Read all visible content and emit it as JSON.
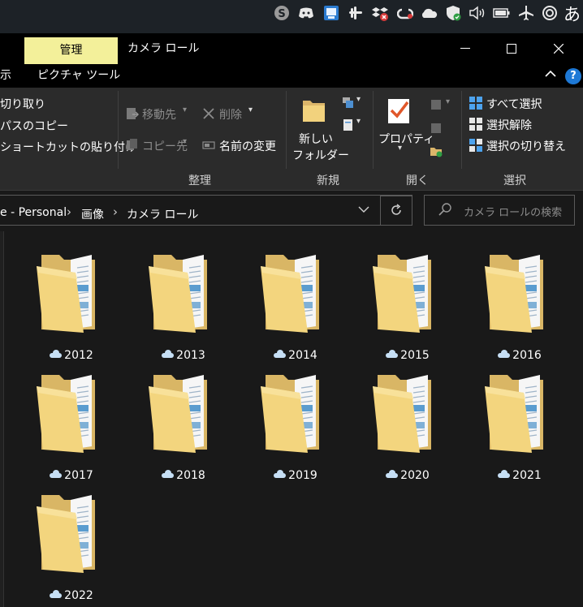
{
  "tray": {
    "icons": [
      "skype-icon",
      "discord-icon",
      "app-icon",
      "slack-icon",
      "dropbox-icon",
      "creative-cloud-icon",
      "onedrive-icon",
      "defender-icon",
      "volume-icon",
      "battery-icon",
      "airplane-icon",
      "target-icon"
    ],
    "ime": "あ"
  },
  "titlebar": {
    "tab_manage": "管理",
    "title": "カメラ ロール",
    "minimize": "—",
    "maximize": "☐",
    "close": "✕"
  },
  "ribbon_tabs": {
    "left_cut": "示",
    "picture_tools": "ピクチャ ツール"
  },
  "ribbon": {
    "clipboard": {
      "cut": "切り取り",
      "copy_path": "パスのコピー",
      "paste_shortcut": "ショートカットの貼り付け"
    },
    "organize": {
      "move_to": "移動先",
      "delete": "削除",
      "copy_to": "コピー先",
      "rename": "名前の変更",
      "label": "整理"
    },
    "new": {
      "new_folder_line1": "新しい",
      "new_folder_line2": "フォルダー",
      "label": "新規"
    },
    "open": {
      "properties": "プロパティ",
      "label": "開く"
    },
    "select": {
      "select_all": "すべて選択",
      "select_none": "選択解除",
      "invert_selection": "選択の切り替え",
      "label": "選択"
    }
  },
  "address": {
    "crumbs": [
      "e - Personal",
      "画像",
      "カメラ ロール"
    ],
    "search_placeholder": "カメラ ロールの検索"
  },
  "folders": [
    {
      "name": "2012"
    },
    {
      "name": "2013"
    },
    {
      "name": "2014"
    },
    {
      "name": "2015"
    },
    {
      "name": "2016"
    },
    {
      "name": "2017"
    },
    {
      "name": "2018"
    },
    {
      "name": "2019"
    },
    {
      "name": "2020"
    },
    {
      "name": "2021"
    },
    {
      "name": "2022"
    }
  ]
}
